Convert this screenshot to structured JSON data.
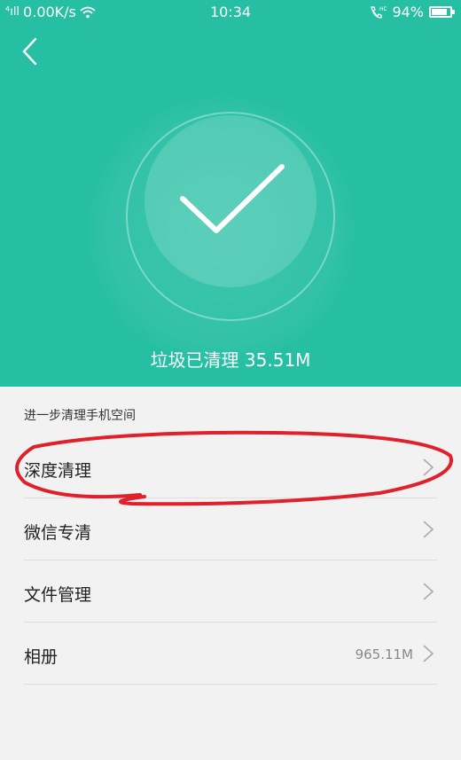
{
  "status_bar": {
    "signal": "⁴ıll",
    "net_speed": "0.00K/s",
    "time": "10:34",
    "battery_percent": "94%",
    "battery_level": 0.94
  },
  "header": {
    "background_color": "#27bfa4",
    "cleaned_text": "垃圾已清理 35.51M"
  },
  "section": {
    "title": "进一步清理手机空间"
  },
  "items": [
    {
      "label": "深度清理",
      "value": ""
    },
    {
      "label": "微信专清",
      "value": ""
    },
    {
      "label": "文件管理",
      "value": ""
    },
    {
      "label": "相册",
      "value": "965.11M"
    }
  ],
  "annotation_color": "#e0202a"
}
